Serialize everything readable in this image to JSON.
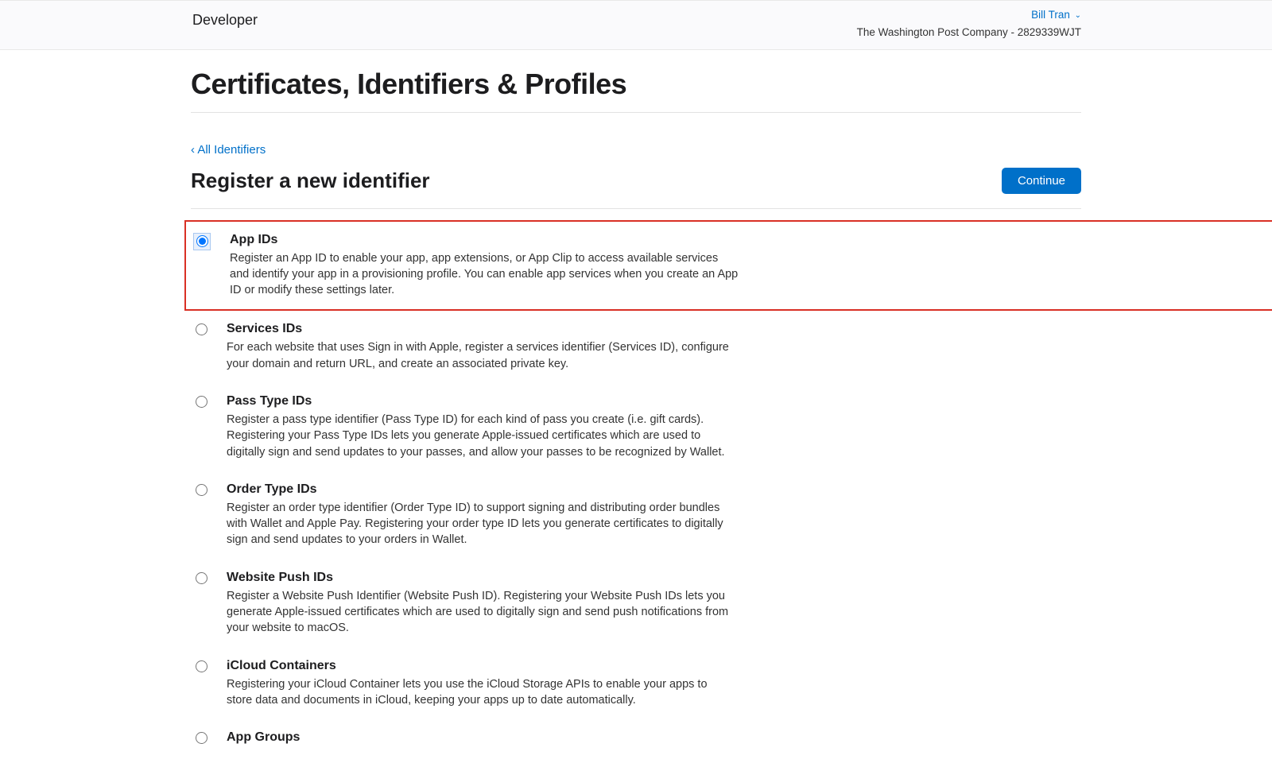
{
  "header": {
    "brand": "Developer",
    "user": "Bill Tran",
    "org": "The Washington Post Company - 2829339WJT"
  },
  "page": {
    "title": "Certificates, Identifiers & Profiles",
    "breadcrumb": "‹ All Identifiers",
    "subtitle": "Register a new identifier",
    "continue": "Continue"
  },
  "options": [
    {
      "id": "app-ids",
      "title": "App IDs",
      "desc": "Register an App ID to enable your app, app extensions, or App Clip to access available services and identify your app in a provisioning profile. You can enable app services when you create an App ID or modify these settings later.",
      "selected": true,
      "highlighted": true
    },
    {
      "id": "services-ids",
      "title": "Services IDs",
      "desc": "For each website that uses Sign in with Apple, register a services identifier (Services ID), configure your domain and return URL, and create an associated private key."
    },
    {
      "id": "pass-type-ids",
      "title": "Pass Type IDs",
      "desc": "Register a pass type identifier (Pass Type ID) for each kind of pass you create (i.e. gift cards). Registering your Pass Type IDs lets you generate Apple-issued certificates which are used to digitally sign and send updates to your passes, and allow your passes to be recognized by Wallet."
    },
    {
      "id": "order-type-ids",
      "title": "Order Type IDs",
      "desc": "Register an order type identifier (Order Type ID) to support signing and distributing order bundles with Wallet and Apple Pay. Registering your order type ID lets you generate certificates to digitally sign and send updates to your orders in Wallet."
    },
    {
      "id": "website-push-ids",
      "title": "Website Push IDs",
      "desc": "Register a Website Push Identifier (Website Push ID). Registering your Website Push IDs lets you generate Apple-issued certificates which are used to digitally sign and send push notifications from your website to macOS."
    },
    {
      "id": "icloud-containers",
      "title": "iCloud Containers",
      "desc": "Registering your iCloud Container lets you use the iCloud Storage APIs to enable your apps to store data and documents in iCloud, keeping your apps up to date automatically."
    },
    {
      "id": "app-groups",
      "title": "App Groups",
      "desc": ""
    }
  ]
}
